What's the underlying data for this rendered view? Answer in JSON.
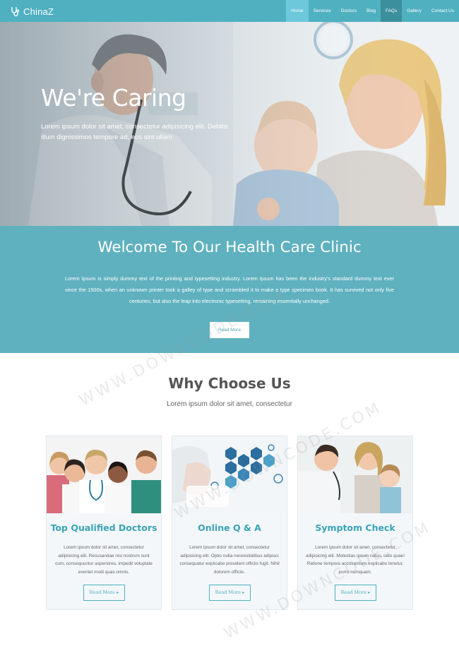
{
  "nav": {
    "brand": "ChinaZ",
    "items": [
      {
        "label": "Home",
        "style": "active"
      },
      {
        "label": "Services",
        "style": ""
      },
      {
        "label": "Doctors",
        "style": ""
      },
      {
        "label": "Blog",
        "style": ""
      },
      {
        "label": "FAQs",
        "style": "dark"
      },
      {
        "label": "Gallery",
        "style": ""
      },
      {
        "label": "Contact Us",
        "style": ""
      }
    ]
  },
  "hero": {
    "title": "We're Caring",
    "subtitle": "Lorem ipsum dolor sit amet, consectetur adipisicing elit. Debitis illum dignissimos tempore ad, eos sint ullam"
  },
  "welcome": {
    "title": "Welcome To Our Health Care Clinic",
    "text": "Lorem Ipsum is simply dummy text of the printing and typesetting industry. Lorem Ipsum has been the industry's standard dummy text ever since the 1500s, when an unknown printer took a galley of type and scrambled it to make a type specimen book. It has survived not only five centuries, but also the leap into electronic typesetting, remaining essentially unchanged.",
    "button": "Read More"
  },
  "why": {
    "title": "Why Choose Us",
    "subtitle": "Lorem ipsum dolor sit amet, consectetur"
  },
  "cards": [
    {
      "title": "Top Qualified Doctors",
      "text": "Lorem ipsum dolor sit amet, consectetur adipisicing elit. Recusandae nisi nostrum sunt cum, consequuntur asperiores, impedit voluptate eveniet modi quas omnis.",
      "button": "Read More"
    },
    {
      "title": "Online Q & A",
      "text": "Lorem ipsum dolor sit amet, consectetur adipisicing elit. Optio nulla necessitatibus adipisci consequatur explicabo provident officiis fugit. Nihil dolorem officiis.",
      "button": "Read More"
    },
    {
      "title": "Symptom Check",
      "text": "Lorem ipsum dolor sit amet, consectetur adipisicing elit. Molestias ipsum natus, odio quae! Ratione tempora accusantium explicabo tenetur, porro numquam.",
      "button": "Read More"
    }
  ],
  "watermark": "WWW.DOWNCODE.COM",
  "colors": {
    "primary": "#4fb0c0",
    "welcome_bg": "#5fb1bf",
    "card_title": "#3aa3b6"
  }
}
